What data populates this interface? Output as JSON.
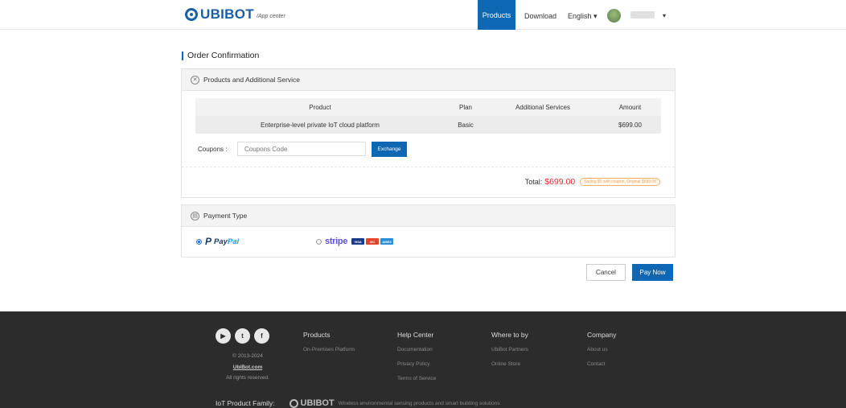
{
  "header": {
    "logo_text": "UBIBOT",
    "logo_sub": "/App center",
    "nav_products": "Products",
    "nav_download": "Download",
    "nav_language": "English ▾",
    "user_caret": "▾"
  },
  "order": {
    "title": "Order Confirmation",
    "products_section_title": "Products and Additional Service",
    "table_headers": {
      "product": "Product",
      "plan": "Plan",
      "services": "Additional Services",
      "amount": "Amount"
    },
    "row": {
      "product": "Enterprise-level private IoT cloud platform",
      "plan": "Basic",
      "services": "",
      "amount": "$699.00"
    },
    "coupon_label": "Coupons :",
    "coupon_placeholder": "Coupons Code",
    "exchange_label": "Exchange",
    "total_label": "Total:",
    "total_value": "$699.00",
    "saving_note": "Saving $0 with coupon, Original $699.00"
  },
  "payment": {
    "section_title": "Payment Type",
    "paypal_pay": "Pay",
    "paypal_pal": "Pal",
    "stripe_label": "stripe",
    "cards": [
      "VISA",
      "MC",
      "AMEX"
    ],
    "selected": "paypal"
  },
  "actions": {
    "cancel_label": "Cancel",
    "paynow_label": "Pay Now"
  },
  "footer": {
    "copyright": "© 2013-2024",
    "site": "UbiBot.com",
    "rights": "All rights reserved.",
    "social_icons": [
      "youtube-icon",
      "twitter-icon",
      "facebook-icon"
    ],
    "columns": [
      {
        "heading": "Products",
        "links": [
          "On-Premises Platform"
        ]
      },
      {
        "heading": "Help Center",
        "links": [
          "Documentation",
          "Privacy Policy",
          "Terms of Service"
        ]
      },
      {
        "heading": "Where to by",
        "links": [
          "UbiBot Partners",
          "Online Store"
        ]
      },
      {
        "heading": "Company",
        "links": [
          "About us",
          "Contact"
        ]
      }
    ],
    "family_label": "IoT Product Family:",
    "family_logo": "UBIBOT",
    "family_desc": "Wireless environmental sensing products and smart building solutions"
  },
  "colors": {
    "primary": "#0e67b3",
    "total_red": "#e62e2e",
    "footer_bg": "#2c2c2c"
  }
}
